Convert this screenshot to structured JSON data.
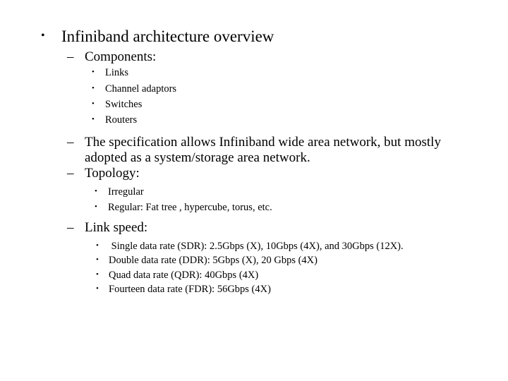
{
  "slide": {
    "background_color": "#ffffff",
    "text_color": "#000000",
    "markers": {
      "level1": "•",
      "level2": "–",
      "level3": "•"
    },
    "outline": {
      "title": "Infiniband architecture overview",
      "components_heading": "Components:",
      "components": [
        "Links",
        "Channel adaptors",
        "Switches",
        "Routers"
      ],
      "specification": "The specification allows Infiniband wide area network, but mostly adopted as a system/storage area network.",
      "topology_heading": "Topology:",
      "topology": [
        "Irregular",
        "Regular: Fat tree , hypercube, torus, etc."
      ],
      "link_speed_heading": "Link speed:",
      "link_speeds": [
        " Single data rate (SDR): 2.5Gbps (X), 10Gbps (4X), and 30Gbps (12X).",
        "Double data rate (DDR): 5Gbps (X), 20 Gbps (4X)",
        "Quad data rate (QDR): 40Gbps (4X)",
        "Fourteen data rate (FDR): 56Gbps (4X)"
      ]
    }
  }
}
